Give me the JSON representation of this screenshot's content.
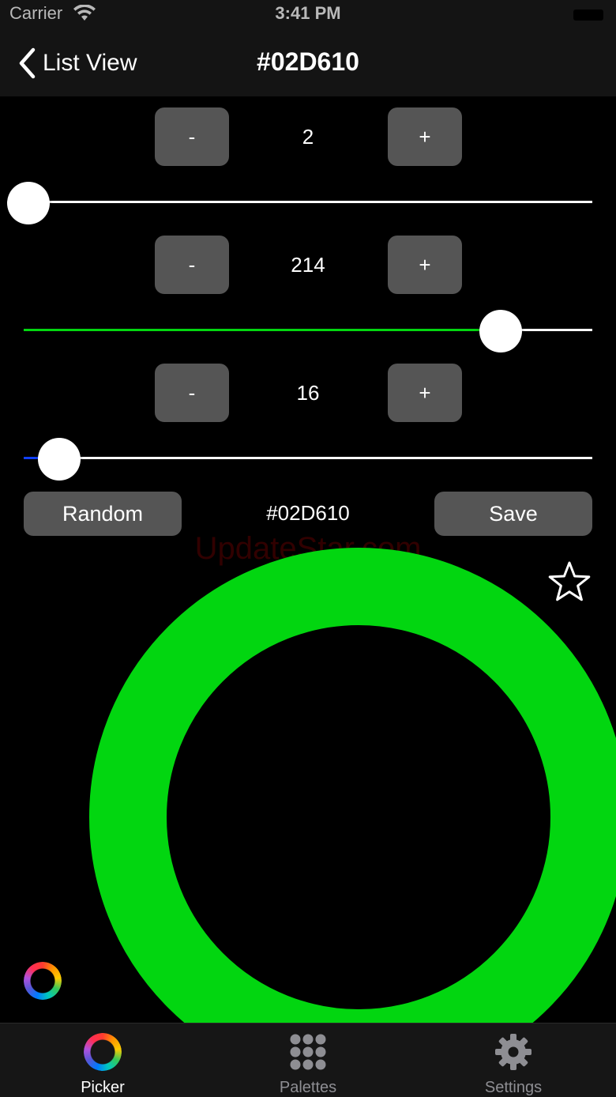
{
  "status_bar": {
    "carrier": "Carrier",
    "time": "3:41 PM"
  },
  "nav": {
    "back_label": "List View",
    "title": "#02D610"
  },
  "channels": [
    {
      "name": "red",
      "value": "2",
      "minus_label": "-",
      "plus_label": "+",
      "fraction": 0.008,
      "color": "#ff3b30"
    },
    {
      "name": "green",
      "value": "214",
      "minus_label": "-",
      "plus_label": "+",
      "fraction": 0.839,
      "color": "#02D610"
    },
    {
      "name": "blue",
      "value": "16",
      "minus_label": "-",
      "plus_label": "+",
      "fraction": 0.063,
      "color": "#1040ff"
    }
  ],
  "actions": {
    "random_label": "Random",
    "hex_value": "#02D610",
    "save_label": "Save"
  },
  "watermark": "UpdateStar.com",
  "preview": {
    "color": "#02D610"
  },
  "tabs": [
    {
      "label": "Picker",
      "icon": "color-wheel-icon",
      "active": true
    },
    {
      "label": "Palettes",
      "icon": "grid-dots-icon",
      "active": false
    },
    {
      "label": "Settings",
      "icon": "gear-icon",
      "active": false
    }
  ],
  "colors": {
    "active_tab": "#ffffff",
    "inactive_tab": "#8e8e93",
    "button_bg": "#555555"
  }
}
